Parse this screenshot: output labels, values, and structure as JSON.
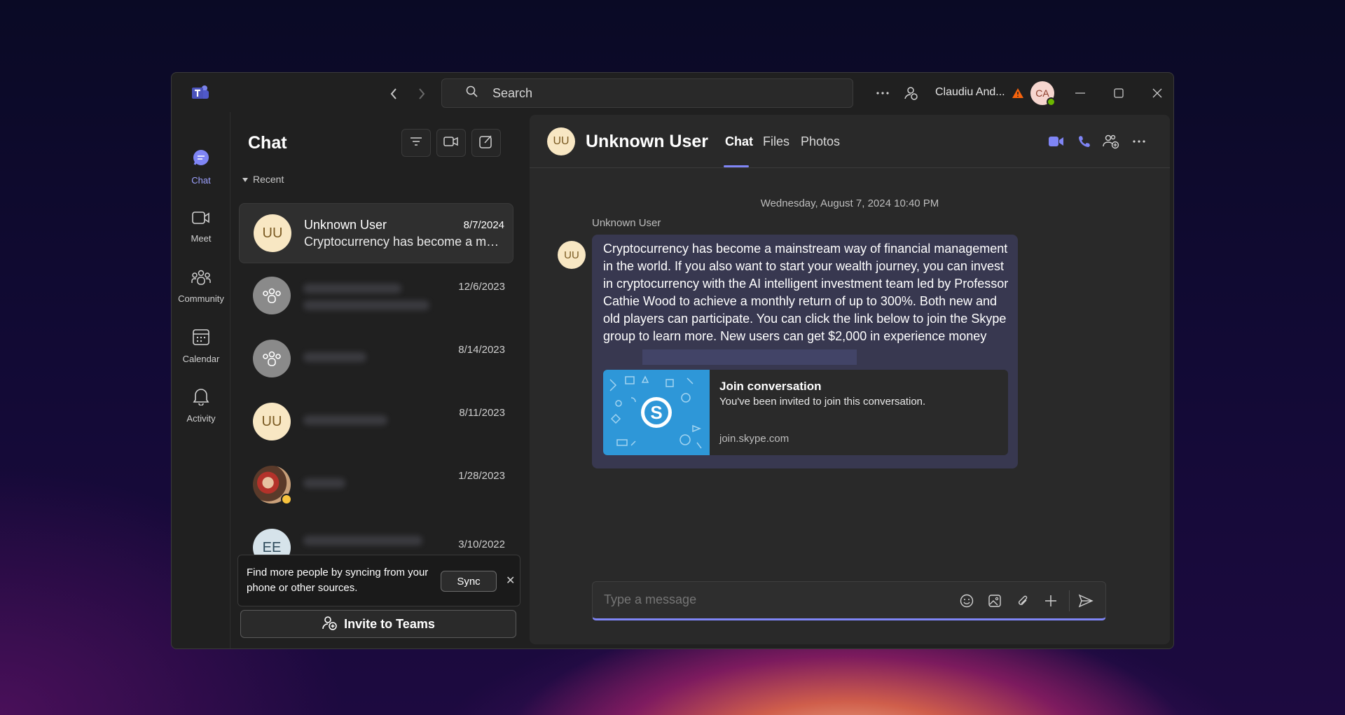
{
  "titlebar": {
    "search_placeholder": "Search",
    "user_name": "Claudiu And...",
    "user_initials": "CA"
  },
  "rail": {
    "items": [
      {
        "label": "Chat",
        "icon": "chat-icon",
        "active": true
      },
      {
        "label": "Meet",
        "icon": "video-icon"
      },
      {
        "label": "Community",
        "icon": "community-icon"
      },
      {
        "label": "Calendar",
        "icon": "calendar-icon"
      },
      {
        "label": "Activity",
        "icon": "bell-icon"
      }
    ]
  },
  "chatlist": {
    "title": "Chat",
    "recent_label": "Recent",
    "rows": [
      {
        "initials": "UU",
        "name": "Unknown User",
        "date": "8/7/2024",
        "preview": "Cryptocurrency has become a mainstream way of financial management in the world."
      },
      {
        "initials": "",
        "name": "",
        "date": "12/6/2023",
        "preview": ""
      },
      {
        "initials": "",
        "name": "",
        "date": "8/14/2023",
        "preview": ""
      },
      {
        "initials": "UU",
        "name": "",
        "date": "8/11/2023",
        "preview": ""
      },
      {
        "initials": "",
        "name": "",
        "date": "1/28/2023",
        "preview": ""
      },
      {
        "initials": "EE",
        "name": "",
        "date": "3/10/2022",
        "preview": ""
      }
    ],
    "sync_text": "Find more people by syncing from your phone or other sources.",
    "sync_button": "Sync",
    "invite_button": "Invite to Teams"
  },
  "conversation": {
    "initials": "UU",
    "name": "Unknown User",
    "tabs": [
      "Chat",
      "Files",
      "Photos"
    ],
    "timestamp": "Wednesday, August 7, 2024 10:40 PM",
    "sender": "Unknown User",
    "message": "Cryptocurrency has become a mainstream way of financial management in the world. If you also want to start your wealth journey, you can invest in cryptocurrency with the AI intelligent investment team led by Professor Cathie Wood to achieve a monthly return of up to 300%. Both new and old players can participate. You can click the link below to join the Skype group to learn more. New users can get $2,000 in experience money",
    "link_card": {
      "title": "Join conversation",
      "description": "You've been invited to join this conversation.",
      "url": "join.skype.com"
    },
    "composer_placeholder": "Type a message"
  },
  "colors": {
    "accent": "#7f85f5",
    "bubble": "#383850",
    "warning": "#f7630c"
  }
}
